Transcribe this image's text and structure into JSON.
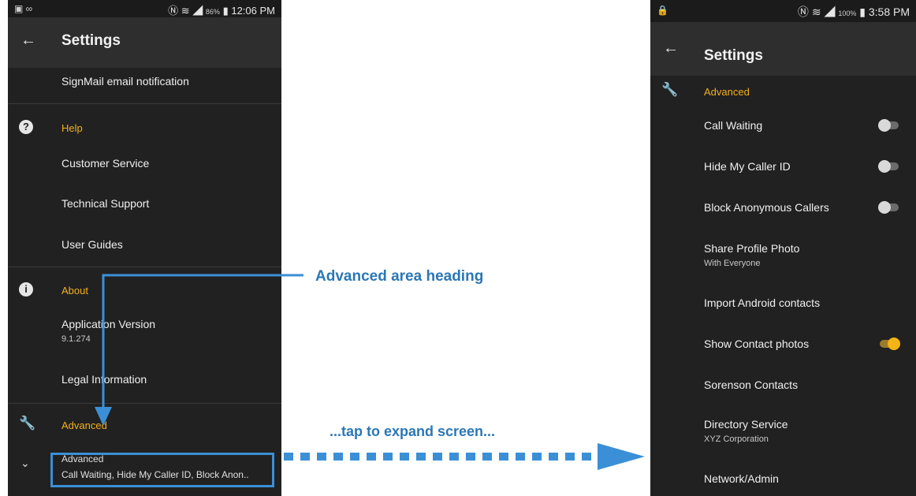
{
  "left_phone": {
    "status": {
      "battery": "86%",
      "time": "12:06 PM"
    },
    "appbar": {
      "title": "Settings"
    },
    "rows": {
      "signmail": "SignMail email notification",
      "help_header": "Help",
      "customer_service": "Customer Service",
      "technical_support": "Technical Support",
      "user_guides": "User Guides",
      "about_header": "About",
      "app_version_label": "Application Version",
      "app_version_value": "9.1.274",
      "legal": "Legal Information",
      "advanced_header": "Advanced",
      "advanced_collapsed_title": "Advanced",
      "advanced_collapsed_summary": "Call Waiting, Hide My Caller ID, Block Anon.."
    }
  },
  "right_phone": {
    "status": {
      "battery": "100%",
      "time": "3:58 PM"
    },
    "appbar": {
      "title": "Settings"
    },
    "rows": {
      "advanced_header": "Advanced",
      "call_waiting": "Call Waiting",
      "hide_caller_id": "Hide My Caller ID",
      "block_anonymous": "Block Anonymous Callers",
      "share_profile_photo": "Share Profile Photo",
      "share_profile_photo_value": "With Everyone",
      "import_contacts": "Import Android contacts",
      "show_contact_photos": "Show Contact photos",
      "sorenson_contacts": "Sorenson Contacts",
      "directory_service": "Directory Service",
      "directory_service_value": "XYZ Corporation",
      "network_admin": "Network/Admin"
    },
    "toggles": {
      "call_waiting": false,
      "hide_caller_id": false,
      "block_anonymous": false,
      "show_contact_photos": true
    }
  },
  "annotations": {
    "heading_callout": "Advanced area heading",
    "expand_callout": "...tap to expand screen..."
  },
  "colors": {
    "accent": "#f2b01e",
    "callout": "#2b77b5",
    "arrow": "#3b8fd6"
  },
  "icons": [
    "back-arrow-icon",
    "help-icon",
    "info-icon",
    "wrench-icon",
    "chevron-down-icon",
    "lock-icon",
    "nfc-icon",
    "wifi-icon",
    "signal-icon",
    "battery-icon"
  ]
}
